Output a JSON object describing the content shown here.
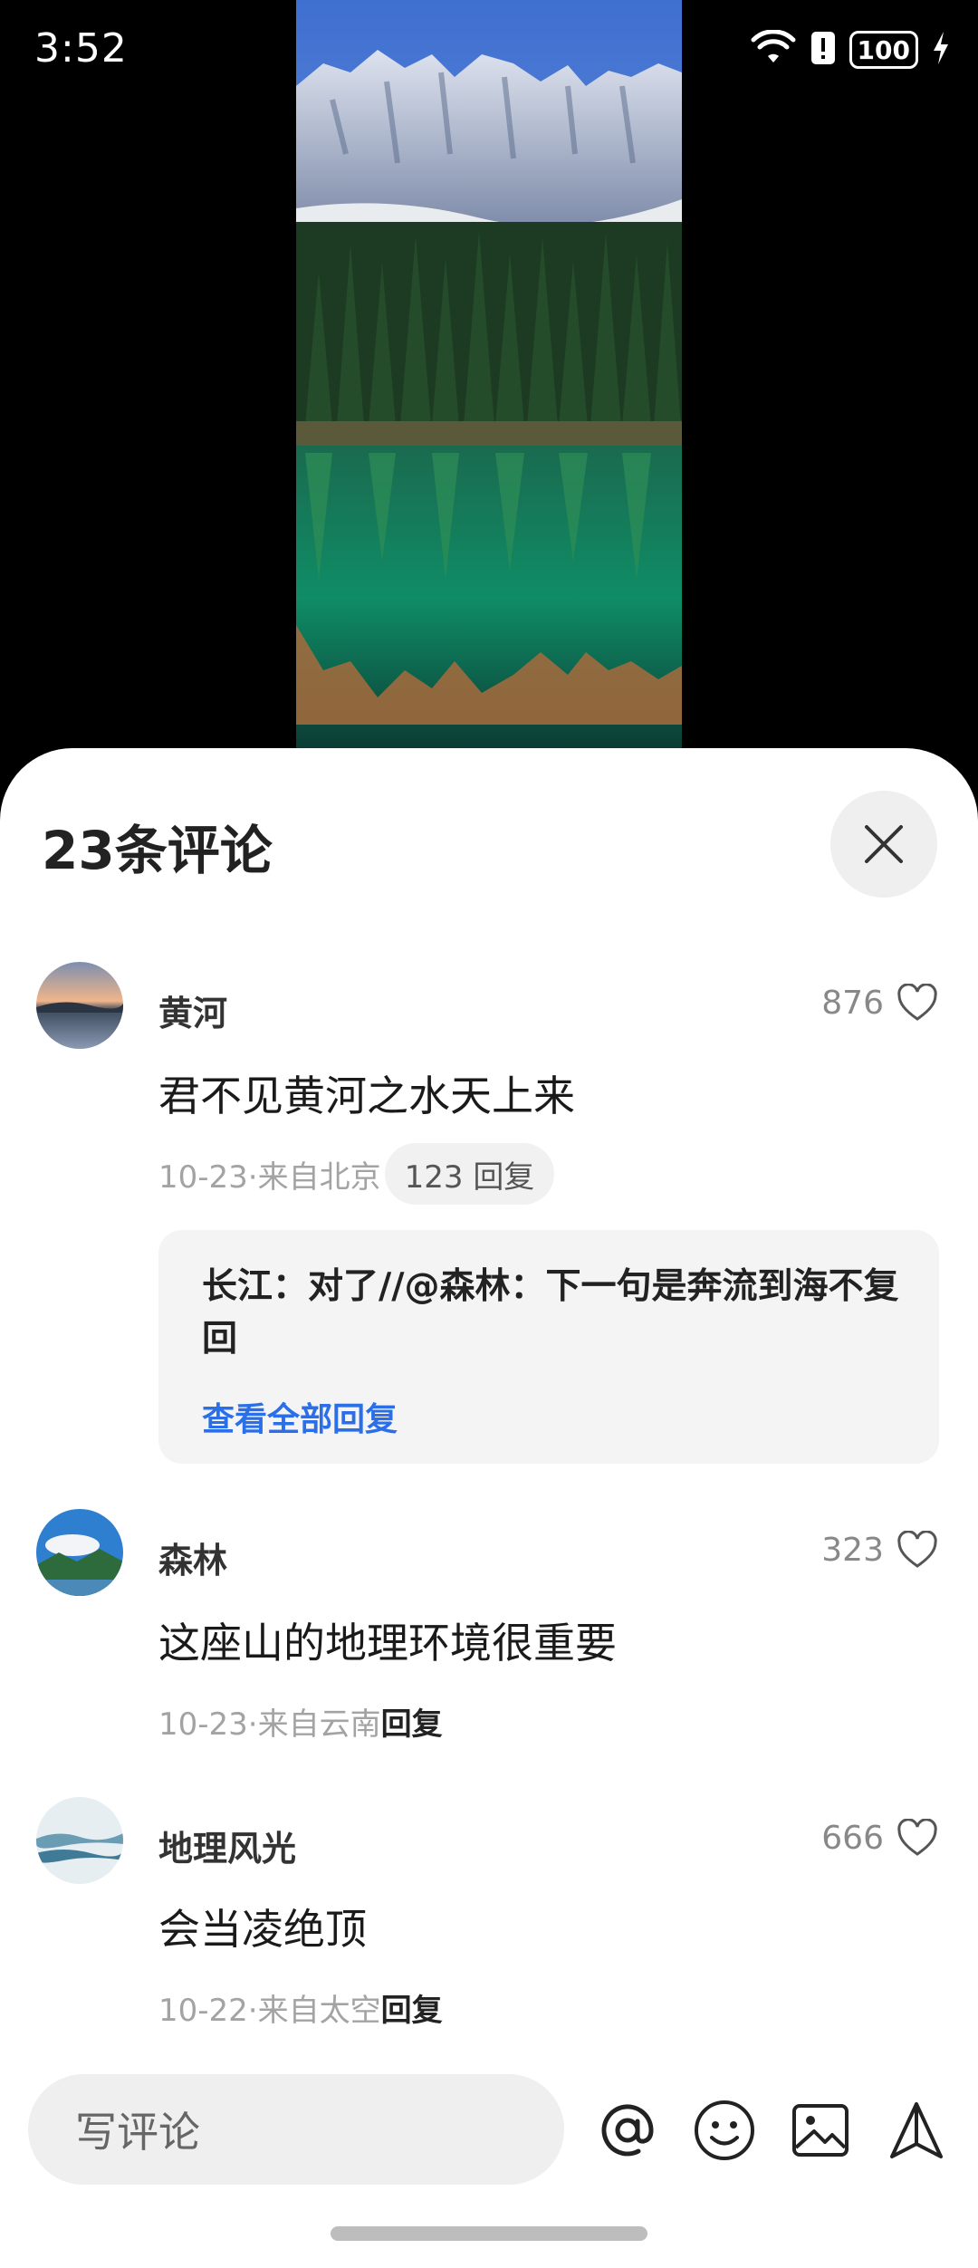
{
  "status_bar": {
    "time": "3:52",
    "battery": "100",
    "icons": [
      "wifi-icon",
      "alert-icon",
      "battery-icon",
      "charging-icon"
    ]
  },
  "comments_panel": {
    "title": "23条评论",
    "comments": [
      {
        "author": "黄河",
        "text": "君不见黄河之水天上来",
        "meta": "10-23·来自北京",
        "reply_count_label": "123 回复",
        "likes": "876",
        "avatar": "sunset-lake-avatar",
        "sub_reply": {
          "text": "长江：对了//@森林：下一句是奔流到海不复回",
          "view_all_label": "查看全部回复"
        }
      },
      {
        "author": "森林",
        "text": "这座山的地理环境很重要",
        "meta": "10-23·来自云南",
        "reply_label": "回复",
        "likes": "323",
        "avatar": "mountain-cloud-avatar"
      },
      {
        "author": "地理风光",
        "text": "会当凌绝顶",
        "meta": "10-22·来自太空",
        "reply_label": "回复",
        "likes": "666",
        "avatar": "misty-mountain-avatar"
      }
    ]
  },
  "input_bar": {
    "placeholder": "写评论",
    "icons": [
      "at-icon",
      "emoji-icon",
      "image-icon",
      "send-icon"
    ]
  },
  "colors": {
    "link": "#2b6fe8",
    "sheet_bg": "#ffffff",
    "pill_bg": "#efefef"
  }
}
